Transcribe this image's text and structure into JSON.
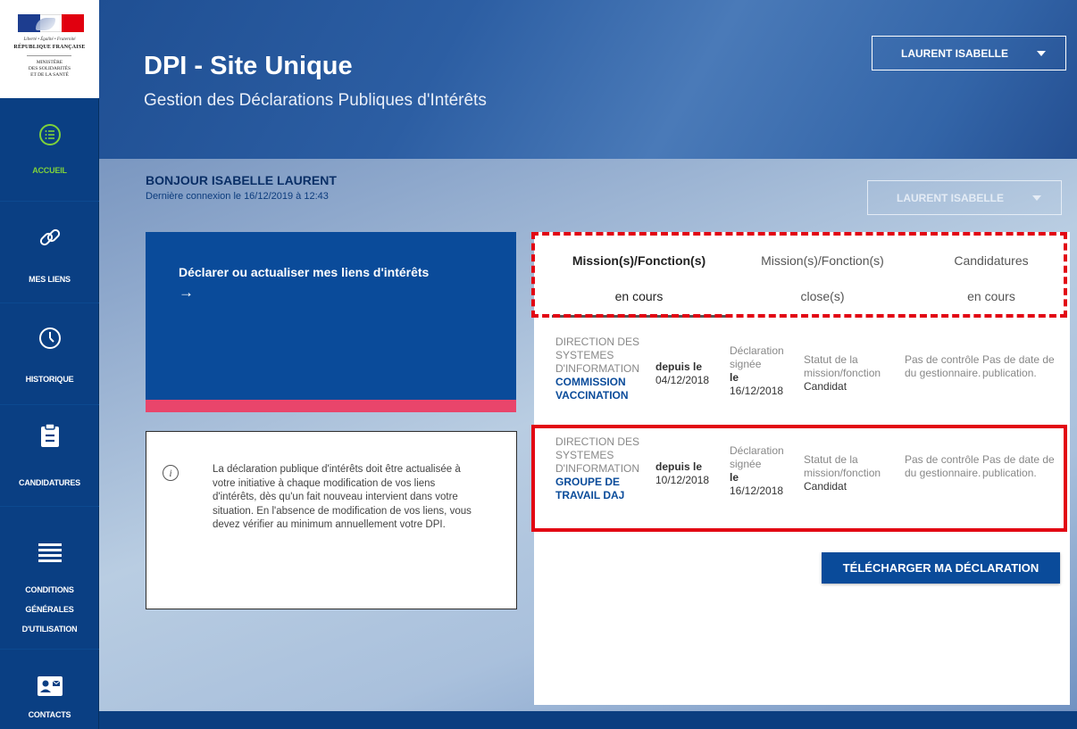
{
  "logo": {
    "motto": "Liberté • Égalité • Fraternité",
    "republic": "RÉPUBLIQUE FRANÇAISE",
    "ministry_line1": "MINISTÈRE",
    "ministry_line2": "DES SOLIDARITÉS",
    "ministry_line3": "ET DE LA SANTÉ"
  },
  "sidebar": {
    "items": [
      {
        "label": "ACCUEIL",
        "icon": "list-circle-icon",
        "active": true
      },
      {
        "label": "MES LIENS",
        "icon": "link-icon"
      },
      {
        "label": "HISTORIQUE",
        "icon": "clock-icon"
      },
      {
        "label": "CANDIDATURES",
        "icon": "clipboard-icon"
      },
      {
        "label_lines": [
          "CONDITIONS",
          "GÉNÉRALES",
          "D'UTILISATION"
        ],
        "icon": "menu-lines-icon"
      },
      {
        "label": "CONTACTS",
        "icon": "contact-card-icon"
      }
    ]
  },
  "header": {
    "title": "DPI - Site Unique",
    "subtitle": "Gestion des Déclarations Publiques d'Intérêts",
    "user_button": "LAURENT ISABELLE"
  },
  "greeting": {
    "hello": "BONJOUR ISABELLE LAURENT",
    "last_login": "Dernière connexion le 16/12/2019 à 12:43",
    "user_select": "LAURENT ISABELLE"
  },
  "declare_card": {
    "text": "Déclarer ou actualiser mes liens d'intérêts",
    "arrow": "→"
  },
  "info_card": {
    "text": "La déclaration publique d'intérêts doit être actualisée à votre initiative à chaque modification de vos liens d'intérêts, dès qu'un fait nouveau intervient dans votre situation. En l'absence de modification de vos liens, vous devez vérifier au minimum annuellement votre DPI."
  },
  "tabs": [
    {
      "line1": "Mission(s)/Fonction(s)",
      "line2": "en cours",
      "active": true
    },
    {
      "line1": "Mission(s)/Fonction(s)",
      "line2": "close(s)"
    },
    {
      "line1": "Candidatures",
      "line2": "en cours"
    }
  ],
  "missions": [
    {
      "dir_l1": "DIRECTION DES",
      "dir_l2": "SYSTEMES",
      "dir_l3": "D'INFORMATION",
      "org_l1": "COMMISSION",
      "org_l2": "VACCINATION",
      "since_label": "depuis le",
      "since_date": "04/12/2018",
      "decl_l1": "Déclaration",
      "decl_l2": "signée",
      "decl_le": "le",
      "decl_date": "16/12/2018",
      "status_label": "Statut de la mission/fonction",
      "status_value": "Candidat",
      "control": "Pas de contrôle du gestionnaire.",
      "publication": "Pas de date de publication."
    },
    {
      "dir_l1": "DIRECTION DES",
      "dir_l2": "SYSTEMES",
      "dir_l3": "D'INFORMATION",
      "org_l1": "GROUPE DE",
      "org_l2": "TRAVAIL DAJ",
      "since_label": "depuis le",
      "since_date": "10/12/2018",
      "decl_l1": "Déclaration",
      "decl_l2": "signée",
      "decl_le": "le",
      "decl_date": "16/12/2018",
      "status_label": "Statut de la mission/fonction",
      "status_value": "Candidat",
      "control": "Pas de contrôle du gestionnaire.",
      "publication": "Pas de date de publication."
    }
  ],
  "download_button": "TÉLÉCHARGER MA DÉCLARATION",
  "colors": {
    "sidebar": "#0a3f83",
    "primary": "#0a4b9a",
    "active_nav": "#7fd23a",
    "accent_bar": "#e9456b",
    "highlight_red": "#e20613"
  }
}
